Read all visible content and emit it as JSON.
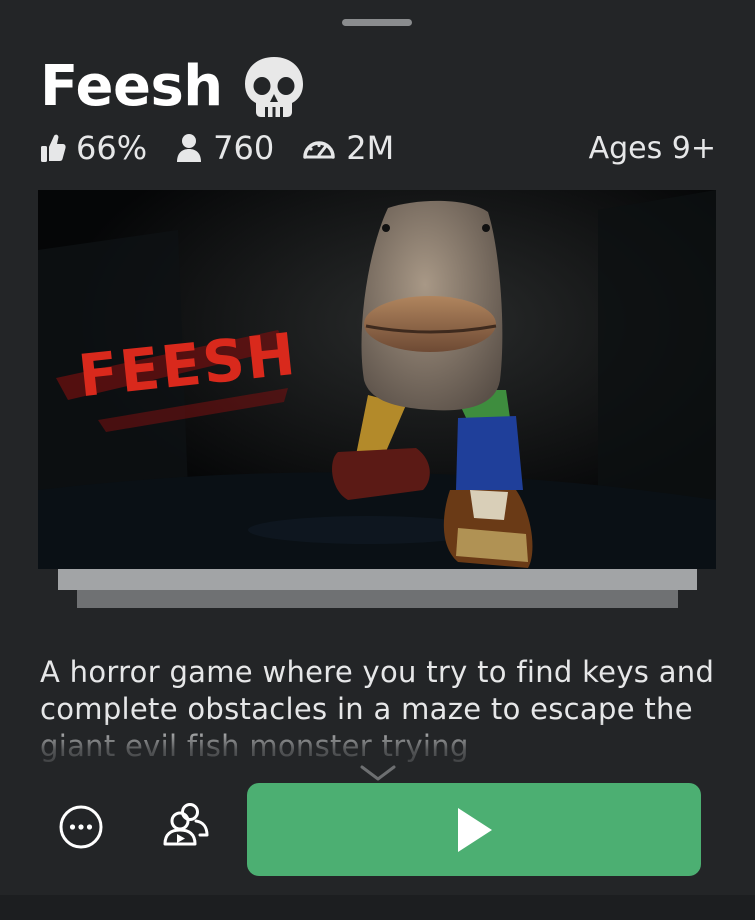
{
  "game": {
    "title": "Feesh",
    "title_emoji": "skull-icon",
    "rating": "66%",
    "playing": "760",
    "visits": "2M",
    "age_rating": "Ages 9+",
    "thumbnail_text": "FEESH",
    "description": "A horror game where you try to find keys and complete obstacles in a maze to escape the giant evil fish monster trying"
  },
  "actions": {
    "more_icon": "more-options-icon",
    "party_icon": "party-icon",
    "play_icon": "play-icon"
  },
  "colors": {
    "background": "#232527",
    "play_button": "#4caf72",
    "text": "#ffffff",
    "muted_text": "#e6e7e8"
  }
}
